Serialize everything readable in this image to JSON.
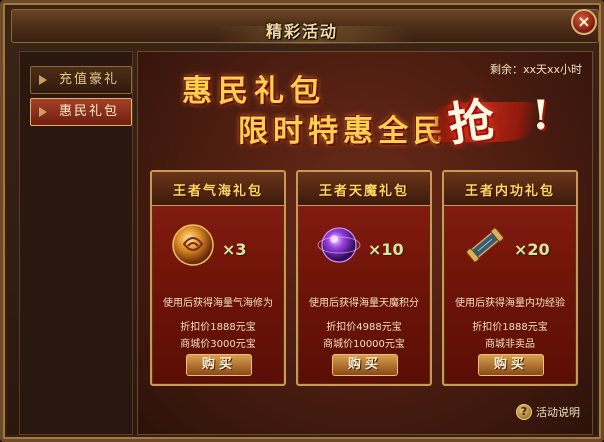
{
  "window": {
    "title": "精彩活动",
    "close_label": "×"
  },
  "sidebar": {
    "items": [
      {
        "label": "充值豪礼",
        "active": false
      },
      {
        "label": "惠民礼包",
        "active": true
      }
    ]
  },
  "banner": {
    "line1": "惠民礼包",
    "line2": "限时特惠全民",
    "highlight": "抢",
    "exclaim": "!"
  },
  "countdown": {
    "label": "剩余：",
    "value": "xx天xx小时"
  },
  "packages": [
    {
      "title": "王者气海礼包",
      "icon": "qi-orb-icon",
      "quantity": "×3",
      "description": "使用后获得海量气海修为",
      "price_line1": "折扣价1888元宝",
      "price_line2": "商城价3000元宝",
      "button": "购买"
    },
    {
      "title": "王者天魔礼包",
      "icon": "purple-orb-icon",
      "quantity": "×10",
      "description": "使用后获得海量天魔积分",
      "price_line1": "折扣价4988元宝",
      "price_line2": "商城价10000元宝",
      "button": "购买"
    },
    {
      "title": "王者内功礼包",
      "icon": "scroll-icon",
      "quantity": "×20",
      "description": "使用后获得海量内功经验",
      "price_line1": "折扣价1888元宝",
      "price_line2": "商城非卖品",
      "button": "购买"
    }
  ],
  "help": {
    "icon": "help-icon",
    "icon_glyph": "?",
    "label": "活动说明"
  },
  "colors": {
    "accent_gold": "#ffd050",
    "panel_red": "#701408",
    "border_gold": "#c89a54"
  }
}
